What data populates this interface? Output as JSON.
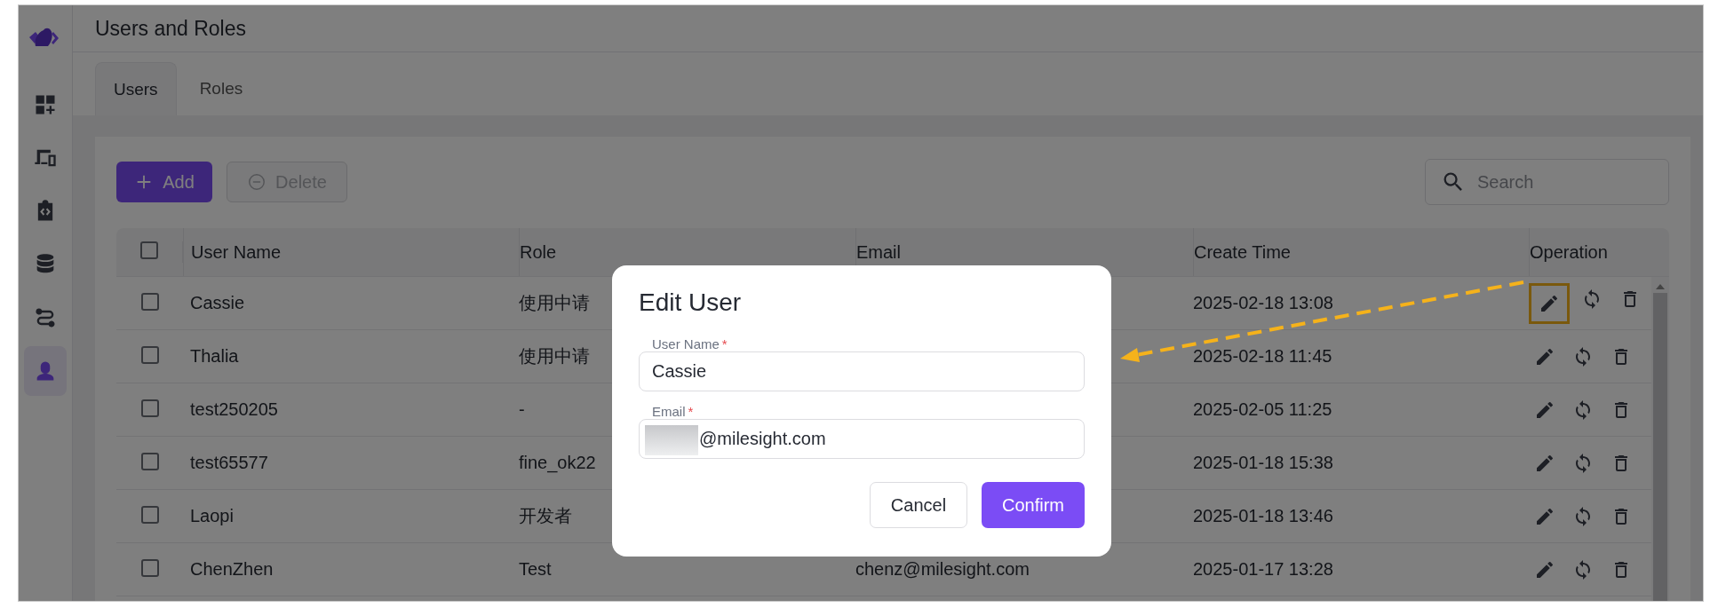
{
  "sidebar": {
    "items": [
      {
        "kind": "dashboard",
        "selected": false
      },
      {
        "kind": "devices",
        "selected": false
      },
      {
        "kind": "integration",
        "selected": false
      },
      {
        "kind": "database",
        "selected": false
      },
      {
        "kind": "workflow",
        "selected": false
      },
      {
        "kind": "user",
        "selected": true
      }
    ]
  },
  "page": {
    "title": "Users and Roles"
  },
  "tabs": [
    {
      "label": "Users",
      "selected": true
    },
    {
      "label": "Roles",
      "selected": false
    }
  ],
  "toolbar": {
    "add_button": {
      "label": "Add"
    },
    "delete_button": {
      "label": "Delete",
      "disabled": true
    },
    "search": {
      "placeholder": "Search"
    }
  },
  "table": {
    "select_all": {
      "checked": false
    },
    "columns": [
      "User Name",
      "Role",
      "Email",
      "Create Time",
      "Operation"
    ],
    "rows": [
      {
        "checked": false,
        "user_name": "Cassie",
        "role": "使用中请",
        "create_time": "2025-02-18 13:08",
        "edit_highlighted": true
      },
      {
        "checked": false,
        "user_name": "Thalia",
        "role": "使用中请",
        "create_time": "2025-02-18 11:45",
        "edit_highlighted": false
      },
      {
        "checked": false,
        "user_name": "test250205",
        "role": "-",
        "create_time": "2025-02-05 11:25",
        "edit_highlighted": false
      },
      {
        "checked": false,
        "user_name": "test65577",
        "role": "fine_ok22",
        "create_time": "2025-01-18 15:38",
        "edit_highlighted": false
      },
      {
        "checked": false,
        "user_name": "Laopi",
        "role": "开发者",
        "create_time": "2025-01-18 13:46",
        "edit_highlighted": false
      },
      {
        "checked": false,
        "user_name": "ChenZhen",
        "role": "Test",
        "email": "chenz@milesight.com",
        "create_time": "2025-01-17 13:28",
        "edit_highlighted": false
      }
    ]
  },
  "dialog": {
    "title": "Edit User",
    "fields": [
      {
        "label": "User Name",
        "required_mark": "*",
        "value": "Cassie"
      },
      {
        "label": "Email",
        "required_mark": "*",
        "value": "@milesight.com",
        "redacted": true
      }
    ],
    "buttons": [
      {
        "kind": "secondary",
        "label": "Cancel"
      },
      {
        "kind": "primary",
        "label": "Confirm"
      }
    ]
  }
}
